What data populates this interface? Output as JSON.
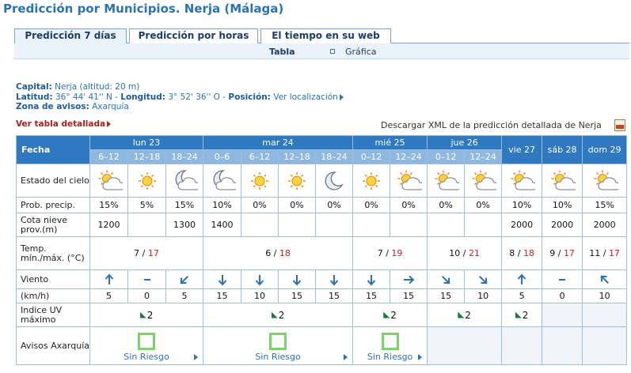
{
  "title": "Predicción por Municipios. Nerja (Málaga)",
  "tabs": [
    {
      "label": "Predicción 7 días"
    },
    {
      "label": "Predicción por horas"
    },
    {
      "label": "El tiempo en su web"
    }
  ],
  "subtabs": {
    "tabla": "Tabla",
    "grafica": "Gráfica"
  },
  "info": {
    "capital_label": "Capital:",
    "capital_value": "Nerja (altitud: 20 m)",
    "latitud_label": "Latitud:",
    "latitud_value": "36° 44' 41'' N",
    "longitud_label": "Longitud:",
    "longitud_value": "3° 52' 36'' O",
    "posicion_label": "Posición:",
    "posicion_link": "Ver localización",
    "zona_label": "Zona de avisos:",
    "zona_value": "Axarquía"
  },
  "detail_link": "Ver tabla detallada",
  "xml_link": "Descargar XML de la predicción detallada de Nerja",
  "table": {
    "fecha": "Fecha",
    "days": [
      "lun 23",
      "mar 24",
      "mié 25",
      "jue 26",
      "vie 27",
      "sáb 28",
      "dom 29"
    ],
    "periods": [
      "6–12",
      "12–18",
      "18–24",
      "0–6",
      "6–12",
      "12–18",
      "18–24",
      "0–12",
      "12–24",
      "0–12",
      "12–24"
    ],
    "labels": {
      "estado": "Estado del cielo",
      "prob": "Prob. precip.",
      "cota": "Cota nieve prov.(m)",
      "temp": "Temp. mín./máx. (°C)",
      "viento": "Viento",
      "kmh": "(km/h)",
      "uv": "Indice UV máximo",
      "avisos": "Avisos Axarquía"
    },
    "sky": [
      "sun-cloud-icon",
      "sun-icon",
      "moon-cloud-icon",
      "moon-cloud-icon",
      "sun-icon",
      "sun-icon",
      "moon-icon",
      "sun-icon",
      "sun-cloud-icon",
      "sun-cloud-icon",
      "sun-cloud-icon",
      "sun-cloud-icon",
      "sun-cloud-icon",
      "sun-cloud-icon"
    ],
    "prob": [
      "15%",
      "5%",
      "15%",
      "10%",
      "0%",
      "0%",
      "0%",
      "0%",
      "0%",
      "0%",
      "0%",
      "10%",
      "10%",
      "15%"
    ],
    "cota": [
      "1200",
      "",
      "1300",
      "1400",
      "",
      "",
      "",
      "",
      "",
      "",
      "",
      "2000",
      "2000",
      "2000"
    ],
    "temp": [
      {
        "min": "7",
        "max": "17"
      },
      {
        "min": "6",
        "max": "18"
      },
      {
        "min": "7",
        "max": "19"
      },
      {
        "min": "10",
        "max": "21"
      },
      {
        "min": "8",
        "max": "18"
      },
      {
        "min": "9",
        "max": "17"
      },
      {
        "min": "11",
        "max": "17"
      }
    ],
    "temp_sep": " / ",
    "wind_icons": [
      "arrow-n-icon",
      "calm-icon",
      "arrow-sw-icon",
      "arrow-s-icon",
      "arrow-s-icon",
      "arrow-s-icon",
      "arrow-s-icon",
      "arrow-s-icon",
      "arrow-e-icon",
      "arrow-se-icon",
      "arrow-se-icon",
      "arrow-n-icon",
      "calm-icon",
      "arrow-nw-icon"
    ],
    "wind_speed": [
      "5",
      "0",
      "5",
      "15",
      "10",
      "15",
      "15",
      "15",
      "15",
      "15",
      "10",
      "5",
      "0",
      "10"
    ],
    "uv": [
      "2",
      "2",
      "2",
      "2",
      "2"
    ],
    "avisos": [
      "Sin Riesgo",
      "Sin Riesgo",
      "Sin Riesgo"
    ]
  },
  "colors": {
    "header_blue": "#2f79c1",
    "period_blue": "#8fb8e1",
    "title_blue": "#2a73b8",
    "max_red": "#d42020",
    "aviso_green": "#7cd46a"
  }
}
